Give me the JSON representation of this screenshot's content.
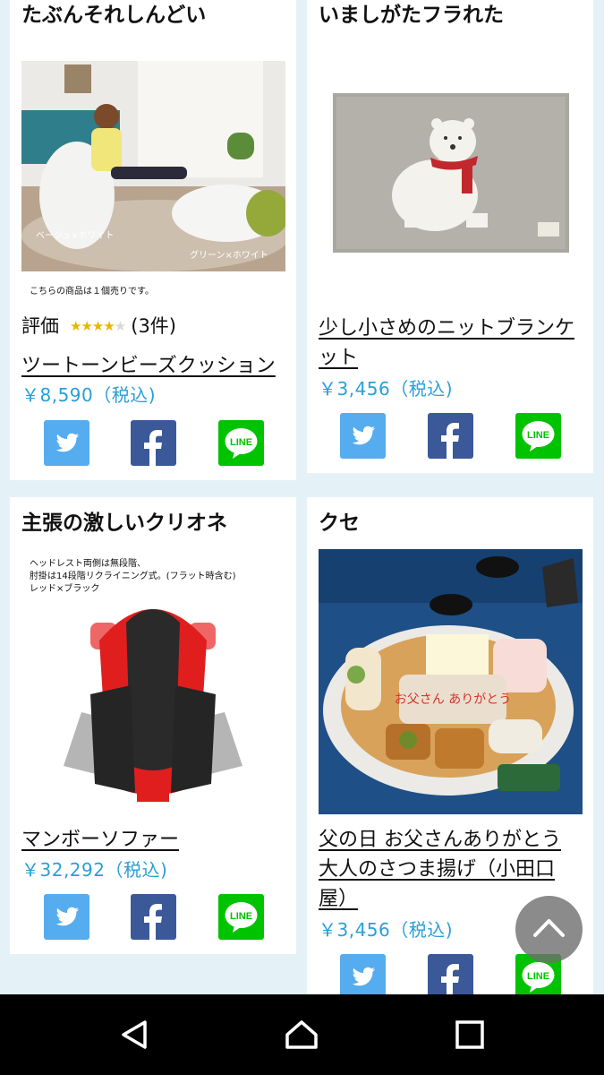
{
  "products": [
    {
      "header": "たぶんそれしんどい",
      "image": "white beanbag chairs in living room",
      "image_captions": [
        "ベージュ×ホワイト",
        "グリーン×ホワイト"
      ],
      "image_note": "こちらの商品は１個売りです。",
      "rating_label": "評価",
      "rating_stars": 4,
      "rating_count": "(3件)",
      "name": "ツートーンビーズクッション",
      "price": "￥8,590（税込)"
    },
    {
      "header": "いましがたフラれた",
      "image": "grey knit blanket with polar bear",
      "name": "少し小さめのニットブランケット",
      "price": "￥3,456（税込)"
    },
    {
      "header": "主張の激しいクリオネ",
      "image": "red and black reclining floor chair",
      "image_note_lines": [
        "ヘッドレスト両側は無段階、",
        "肘掛は14段階リクライニング式。(フラット時含む)",
        "レッド×ブラック"
      ],
      "name": "マンボーソファー",
      "price": "￥32,292（税込)"
    },
    {
      "header": "クセ",
      "image": "platter of satsuma-age fish cakes",
      "image_text": "お父さん ありがとう",
      "name": "父の日 お父さんありがとう 大人のさつま揚げ（小田口屋）",
      "price": "￥3,456（税込)"
    }
  ],
  "share_labels": {
    "twitter": "twitter-icon",
    "facebook": "facebook-icon",
    "line": "LINE"
  },
  "colors": {
    "background": "#e4f2f8",
    "price": "#2a9fd6",
    "twitter": "#55acee",
    "facebook": "#3b5998",
    "line": "#00c300"
  },
  "navbar": {
    "buttons": [
      "back-icon",
      "home-icon",
      "recents-icon"
    ]
  }
}
